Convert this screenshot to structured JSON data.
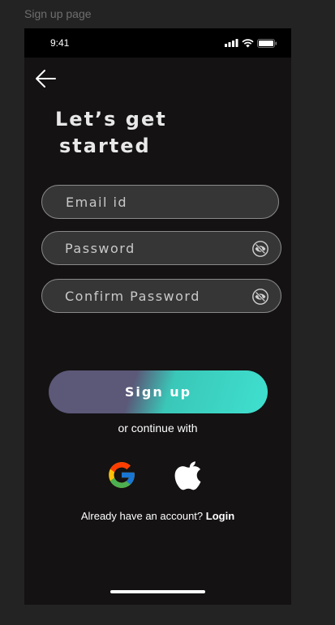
{
  "canvas": {
    "frame_label": "Sign up page"
  },
  "status_bar": {
    "time": "9:41",
    "icons": [
      "signal-icon",
      "wifi-icon",
      "battery-icon"
    ]
  },
  "header": {
    "back_icon": "arrow-left-icon"
  },
  "title": {
    "line1": "Let’s get",
    "line2": "started"
  },
  "form": {
    "email_placeholder": "Email id",
    "password_placeholder": "Password",
    "confirm_password_placeholder": "Confirm Password",
    "visibility_icon": "eye-off-icon"
  },
  "signup_button": {
    "label": "Sign up"
  },
  "social": {
    "label": "or continue with",
    "providers": [
      "google-icon",
      "apple-icon"
    ]
  },
  "account_prompt": {
    "text": "Already have an account?",
    "link": "Login"
  },
  "colors": {
    "background": "#141213",
    "field_fill": "#363636",
    "field_border": "#8a8a8a",
    "gradient_start": "#5b5878",
    "gradient_end": "#3fe0cf"
  }
}
